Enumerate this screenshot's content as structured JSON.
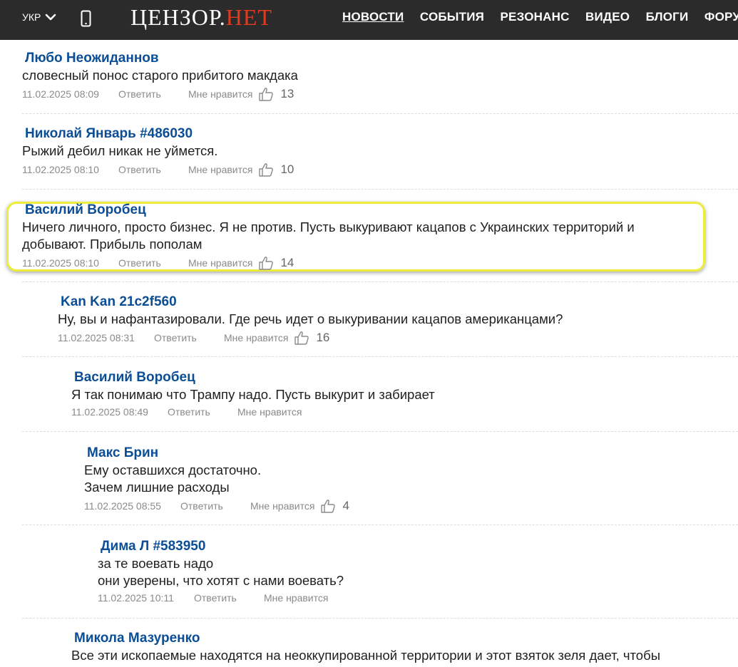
{
  "header": {
    "lang": "УКР",
    "logo_part1": "ЦЕНЗОР",
    "logo_dot": ".",
    "logo_part2": "НЕТ",
    "nav": [
      "НОВОСТИ",
      "СОБЫТИЯ",
      "РЕЗОНАНС",
      "ВИДЕО",
      "БЛОГИ",
      "ФОРУМ"
    ]
  },
  "labels": {
    "reply": "Ответить",
    "like": "Мне нравится"
  },
  "comments": [
    {
      "author": "Любо Неожиданнов",
      "lines": [
        "словесный понос старого прибитого макдака"
      ],
      "date": "11.02.2025 08:09",
      "likes": "13"
    },
    {
      "author": "Николай Январь #486030",
      "lines": [
        "Рыжий дебил никак не уймется."
      ],
      "date": "11.02.2025 08:10",
      "likes": "10"
    },
    {
      "author": "Василий Воробец",
      "lines": [
        "Ничего личного, просто бизнес. Я не против. Пусть выкуривают кацапов с Украинских территорий и",
        "добывают. Прибыль пополам"
      ],
      "date": "11.02.2025 08:10",
      "likes": "14"
    },
    {
      "author": "Kan Kan 21c2f560",
      "lines": [
        "Ну, вы и нафантазировали. Где речь идет о выкуривании кацапов американцами?"
      ],
      "date": "11.02.2025 08:31",
      "likes": "16"
    },
    {
      "author": "Василий Воробец",
      "lines": [
        "Я так понимаю что Трампу надо. Пусть выкурит и забирает"
      ],
      "date": "11.02.2025 08:49",
      "likes": ""
    },
    {
      "author": "Макс Брин",
      "lines": [
        "Ему оставшихся достаточно.",
        "Зачем лишние расходы"
      ],
      "date": "11.02.2025 08:55",
      "likes": "4"
    },
    {
      "author": "Дима Л #583950",
      "lines": [
        "за те воевать надо",
        "они уверены, что хотят с нами воевать?"
      ],
      "date": "11.02.2025 10:11",
      "likes": ""
    },
    {
      "author": "Микола Мазуренко",
      "lines": [
        "Все эти ископаемые находятся на неоккупированной территории и этот взяток зеля дает, чтобы"
      ],
      "date": "",
      "likes": ""
    }
  ]
}
